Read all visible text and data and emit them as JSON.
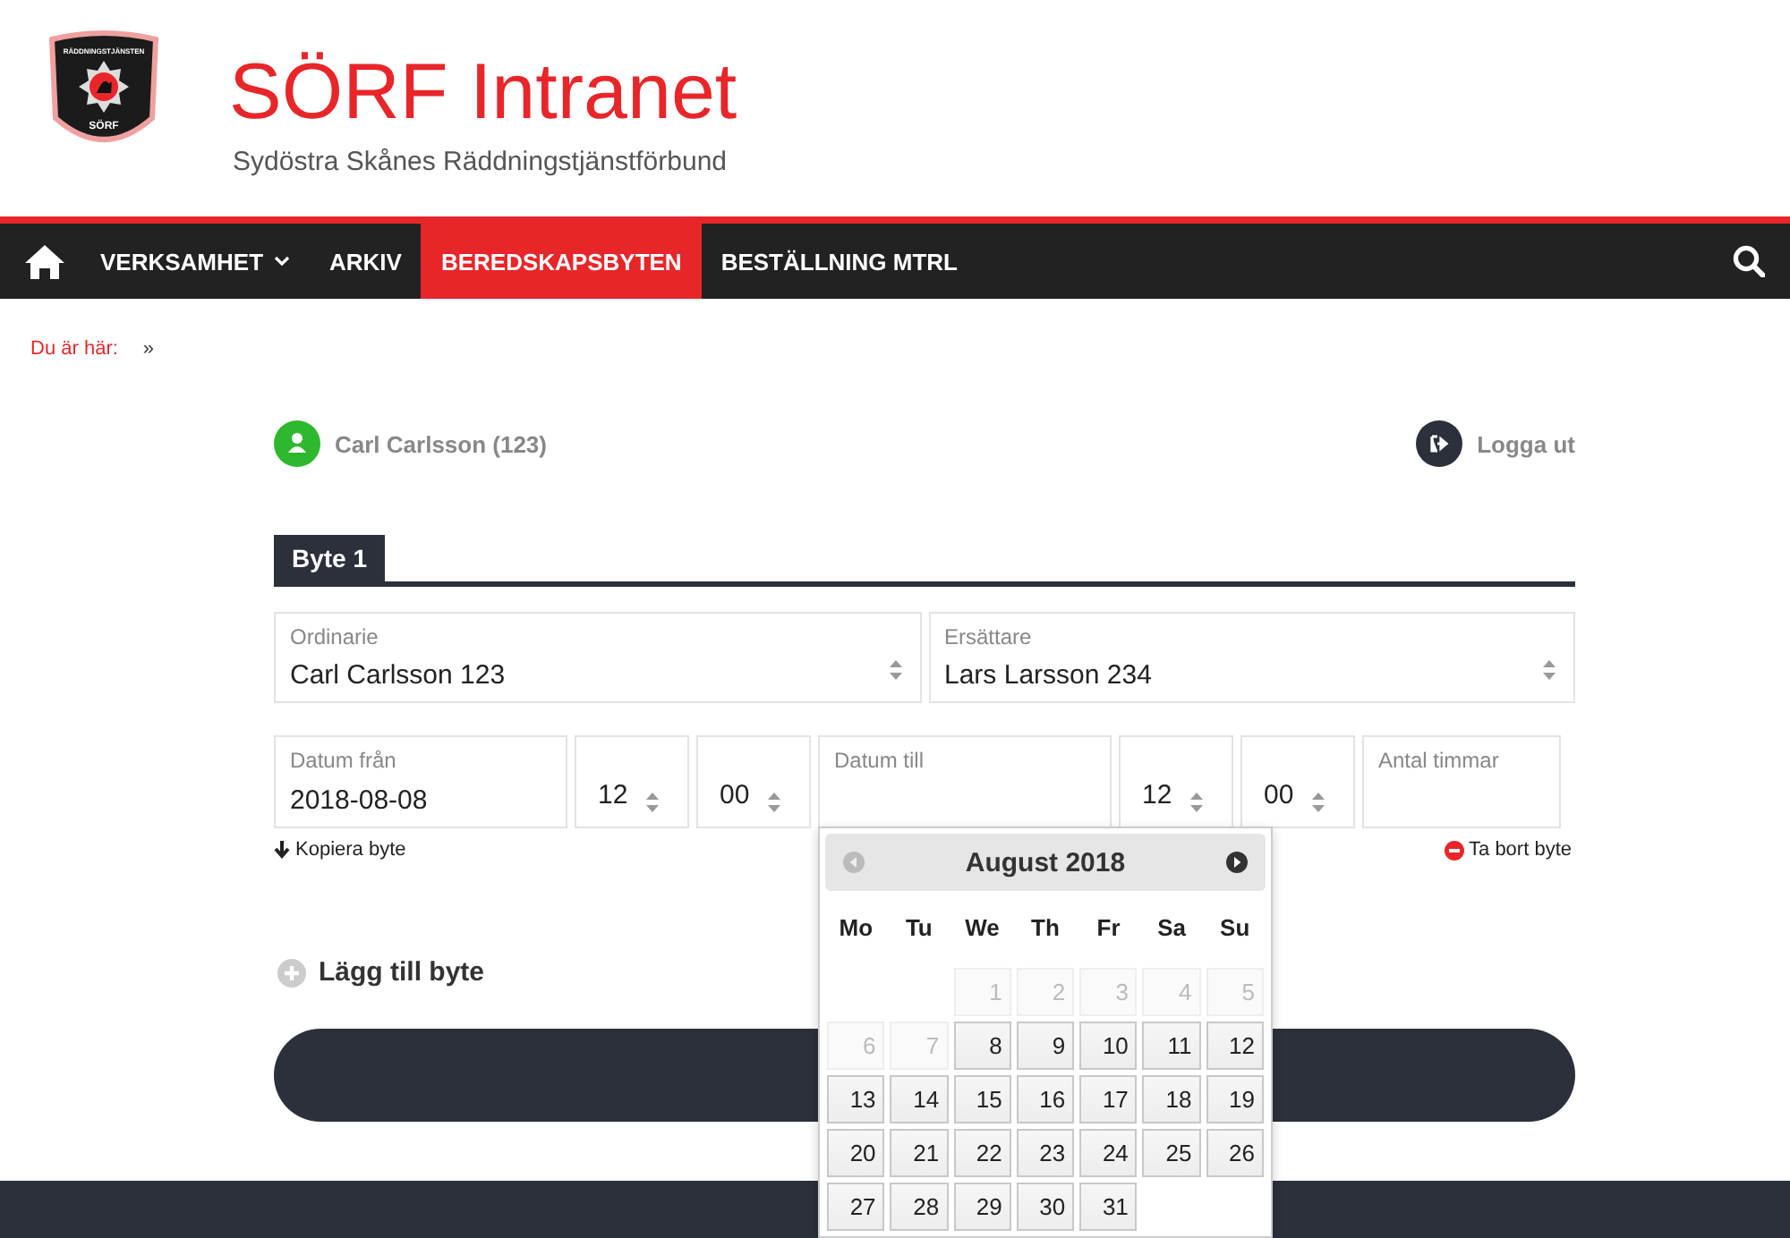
{
  "header": {
    "title": "SÖRF Intranet",
    "subtitle": "Sydöstra Skånes Räddningstjänstförbund",
    "logo_top": "RÄDDNINGSTJÄNSTEN",
    "logo_bottom": "SÖRF"
  },
  "nav": [
    {
      "label": "VERKSAMHET",
      "dropdown": true,
      "selected": false
    },
    {
      "label": "ARKIV",
      "dropdown": false,
      "selected": false
    },
    {
      "label": "BEREDSKAPSBYTEN",
      "dropdown": false,
      "selected": true
    },
    {
      "label": "BESTÄLLNING MTRL",
      "dropdown": false,
      "selected": false
    }
  ],
  "breadcrumb": {
    "label": "Du är här:",
    "separator": "»"
  },
  "user": {
    "name": "Carl Carlsson (123)",
    "logout": "Logga ut"
  },
  "tabs": [
    {
      "label": "Byte 1",
      "selected": true
    }
  ],
  "rows": [
    [
      {
        "kind": "select",
        "label": "Ordinarie",
        "value": "Carl Carlsson 123"
      },
      {
        "kind": "select",
        "label": "Ersättare",
        "value": "Lars Larsson 234"
      }
    ],
    [
      {
        "kind": "text",
        "label": "Datum från",
        "value": "2018-08-08"
      },
      {
        "kind": "spinner",
        "value": "12"
      },
      {
        "kind": "spinner",
        "value": "00"
      },
      {
        "kind": "text",
        "label": "Datum till",
        "calendar": true
      },
      {
        "kind": "spinner",
        "value": "12"
      },
      {
        "kind": "spinner",
        "value": "00"
      },
      {
        "kind": "text",
        "label": "Antal timmar"
      }
    ]
  ],
  "copy_link": "Kopiera byte",
  "remove_link": "Ta bort byte",
  "add_link": "Lägg till byte",
  "calendar": {
    "title": "August 2018",
    "prev_disabled": true,
    "weekdays": [
      "Mo",
      "Tu",
      "We",
      "Th",
      "Fr",
      "Sa",
      "Su"
    ],
    "weeks": [
      [
        {
          "label": "1",
          "disabled": true
        },
        {
          "label": "2",
          "disabled": true
        },
        {
          "label": "3",
          "disabled": true
        },
        {
          "label": "4",
          "disabled": true
        },
        {
          "label": "5",
          "disabled": true
        }
      ],
      [
        {
          "label": "6",
          "disabled": true
        },
        {
          "label": "7",
          "disabled": true
        },
        {
          "label": "8",
          "disabled": false
        },
        {
          "label": "9",
          "disabled": false
        },
        {
          "label": "10",
          "disabled": false
        },
        {
          "label": "11",
          "disabled": false
        },
        {
          "label": "12",
          "disabled": false
        }
      ],
      [
        {
          "label": "13",
          "disabled": false
        },
        {
          "label": "14",
          "disabled": false
        },
        {
          "label": "15",
          "disabled": false
        },
        {
          "label": "16",
          "disabled": false
        },
        {
          "label": "17",
          "disabled": false
        },
        {
          "label": "18",
          "disabled": false
        },
        {
          "label": "19",
          "disabled": false
        }
      ],
      [
        {
          "label": "20",
          "disabled": false
        },
        {
          "label": "21",
          "disabled": false
        },
        {
          "label": "22",
          "disabled": false
        },
        {
          "label": "23",
          "disabled": false
        },
        {
          "label": "24",
          "disabled": false
        },
        {
          "label": "25",
          "disabled": false
        },
        {
          "label": "26",
          "disabled": false
        }
      ],
      [
        {
          "label": "27",
          "disabled": false
        },
        {
          "label": "28",
          "disabled": false
        },
        {
          "label": "29",
          "disabled": false
        },
        {
          "label": "30",
          "disabled": false
        },
        {
          "label": "31",
          "disabled": false
        }
      ]
    ]
  }
}
